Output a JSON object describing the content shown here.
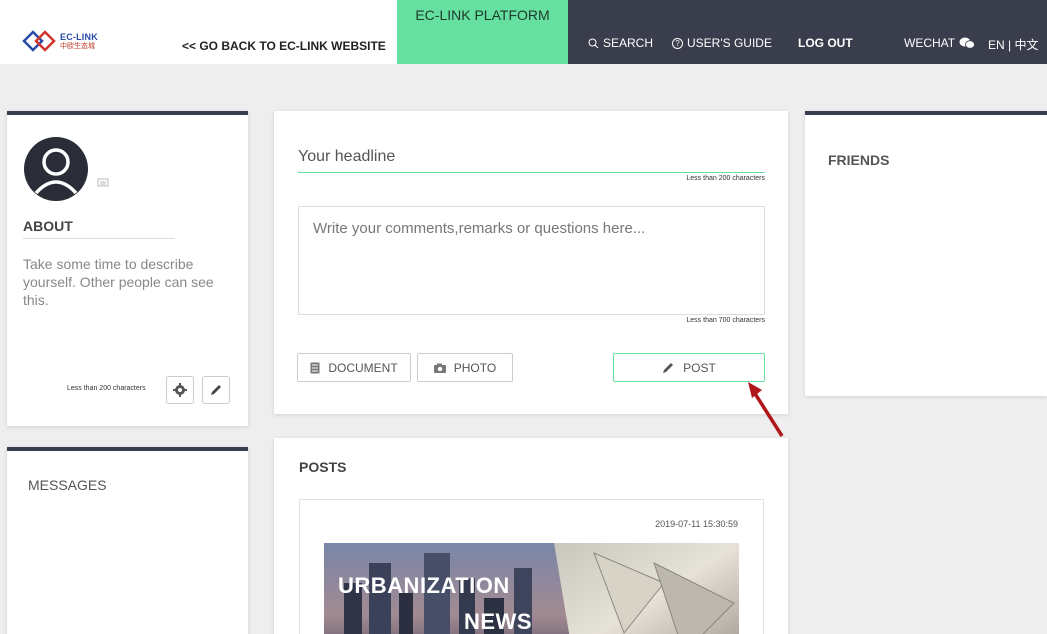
{
  "header": {
    "logo_en": "EC-LINK",
    "logo_cn": "中欧生态城",
    "back_link": "<< GO BACK TO EC-LINK WEBSITE",
    "platform_label": "EC-LINK PLATFORM",
    "nav": {
      "search": "SEARCH",
      "guide": "USER'S GUIDE",
      "logout": "LOG OUT",
      "wechat": "WECHAT",
      "lang": "EN | 中文"
    }
  },
  "profile": {
    "about_title": "ABOUT",
    "about_text": "Take some time to describe yourself. Other people can see this.",
    "limit_text": "Less than 200 characters"
  },
  "messages": {
    "title": "MESSAGES"
  },
  "composer": {
    "headline_placeholder": "Your headline",
    "headline_limit": "Less than 200 characters",
    "comment_placeholder": "Write your comments,remarks or questions here...",
    "comment_limit": "Less than 700 characters",
    "document_label": "DOCUMENT",
    "photo_label": "PHOTO",
    "post_label": "POST"
  },
  "posts": {
    "title": "POSTS",
    "items": [
      {
        "date": "2019-07-11 15:30:59",
        "image_text_1": "URBANIZATION",
        "image_text_2": "NEWS"
      }
    ]
  },
  "friends": {
    "title": "FRIENDS"
  },
  "colors": {
    "accent_green": "#66e0a0",
    "nav_dark": "#3a3e4c",
    "arrow_red": "#b0171a"
  }
}
